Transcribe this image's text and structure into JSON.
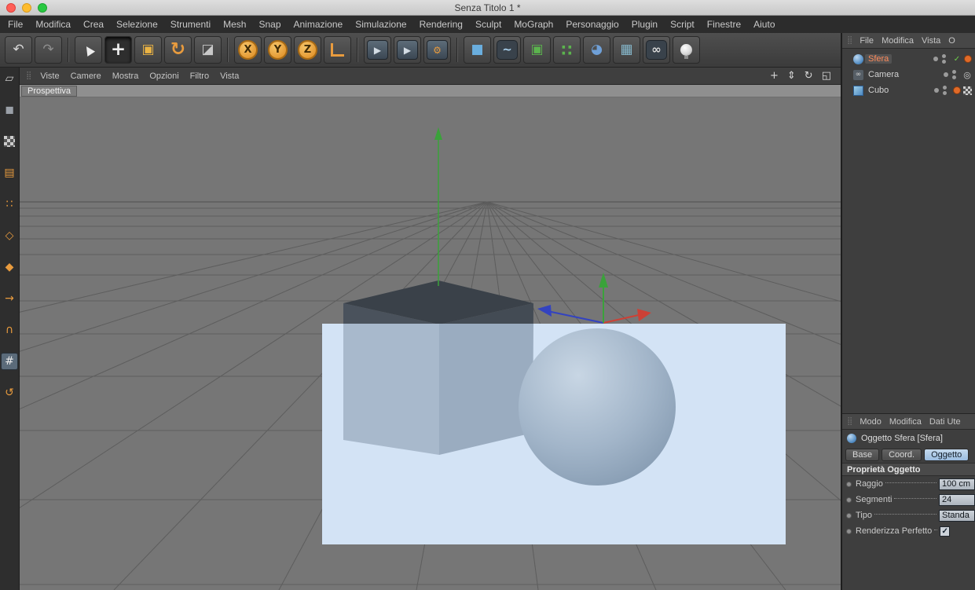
{
  "window": {
    "title": "Senza Titolo 1 *"
  },
  "colors": {
    "accent_orange": "#e89b3e",
    "selected_object_text": "#ff8a5a",
    "axis_x": "#cc4136",
    "axis_y": "#3aa23a",
    "axis_z": "#3343c0",
    "render_region_blue": "#d3e3f5",
    "active_tab_blue": "#a9c6e4"
  },
  "menu_bar": {
    "items": [
      "File",
      "Modifica",
      "Crea",
      "Selezione",
      "Strumenti",
      "Mesh",
      "Snap",
      "Animazione",
      "Simulazione",
      "Rendering",
      "Sculpt",
      "MoGraph",
      "Personaggio",
      "Plugin",
      "Script",
      "Finestre",
      "Aiuto"
    ]
  },
  "toolbar": {
    "items": [
      {
        "name": "undo-icon",
        "glyph": "↶",
        "color": "#d9d9d9"
      },
      {
        "name": "redo-icon",
        "glyph": "↷",
        "color": "#8f8f8f"
      },
      {
        "name": "sep"
      },
      {
        "name": "live-selection-icon",
        "glyph": "▲",
        "color": "#ededed",
        "cls": "cursor"
      },
      {
        "name": "move-tool-icon",
        "glyph": "+",
        "color": "#ededed",
        "cls": "big",
        "pressed": true
      },
      {
        "name": "scale-tool-icon",
        "glyph": "▣",
        "color": "#eab344"
      },
      {
        "name": "rotate-tool-icon",
        "glyph": "↻",
        "color": "#e89b3e",
        "cls": "big"
      },
      {
        "name": "last-tool-icon",
        "glyph": "◪",
        "color": "#c9c9c9"
      },
      {
        "name": "sep"
      },
      {
        "name": "lock-x-axis-icon",
        "glyph": "X",
        "cls": "axis"
      },
      {
        "name": "lock-y-axis-icon",
        "glyph": "Y",
        "cls": "axis"
      },
      {
        "name": "lock-z-axis-icon",
        "glyph": "Z",
        "cls": "axis"
      },
      {
        "name": "coordinate-system-icon",
        "glyph": "",
        "cls": "coord"
      },
      {
        "name": "sep"
      },
      {
        "name": "render-view-icon",
        "glyph": "▶",
        "color": "#d3dce4",
        "cls": "render"
      },
      {
        "name": "render-picture-viewer-icon",
        "glyph": "▶",
        "color": "#d3dce4",
        "cls": "render"
      },
      {
        "name": "render-settings-icon",
        "glyph": "⚙",
        "color": "#e89b3e",
        "cls": "render"
      },
      {
        "name": "sep"
      },
      {
        "name": "add-cube-icon",
        "glyph": "■",
        "color": "#6aaede"
      },
      {
        "name": "add-spline-icon",
        "glyph": "~",
        "color": "#a9d0ec",
        "cls": "dark"
      },
      {
        "name": "subdivision-surface-icon",
        "glyph": "▣",
        "color": "#5cb44e"
      },
      {
        "name": "cloner-icon",
        "glyph": "∷",
        "color": "#5cb44e",
        "cls": "big2"
      },
      {
        "name": "deformer-icon",
        "glyph": "◕",
        "color": "#6fa0d8"
      },
      {
        "name": "environment-icon",
        "glyph": "▦",
        "color": "#86b8cc"
      },
      {
        "name": "scene-camera-icon",
        "glyph": "∞",
        "color": "#dcdcdc",
        "cls": "dark"
      },
      {
        "name": "light-icon",
        "glyph": "",
        "cls": "bulb"
      }
    ]
  },
  "sidebar": {
    "items": [
      {
        "name": "make-editable-icon",
        "glyph": "▱",
        "color": "#c9c9c9"
      },
      {
        "name": "model-mode-icon",
        "glyph": "◼",
        "color": "#9aa0a8"
      },
      {
        "name": "texture-mode-icon",
        "glyph": "",
        "cls": "checker"
      },
      {
        "name": "workplane-mode-icon",
        "glyph": "▤",
        "color": "#e89b3e"
      },
      {
        "name": "points-mode-icon",
        "glyph": "∷",
        "color": "#e89b3e"
      },
      {
        "name": "edges-mode-icon",
        "glyph": "◇",
        "color": "#e89b3e"
      },
      {
        "name": "polygons-mode-icon",
        "glyph": "◆",
        "color": "#e89b3e"
      },
      {
        "name": "enable-axis-icon",
        "glyph": "→",
        "color": "#e89b3e"
      },
      {
        "name": "normal-move-icon",
        "glyph": "∩",
        "color": "#e89b3e"
      },
      {
        "name": "snap-toggle-icon",
        "glyph": "#",
        "color": "#e8e8e8",
        "selected": true
      },
      {
        "name": "quantize-icon",
        "glyph": "↺",
        "color": "#e89b3e"
      }
    ]
  },
  "viewport": {
    "menu": [
      "Viste",
      "Camere",
      "Mostra",
      "Opzioni",
      "Filtro",
      "Vista"
    ],
    "view_label": "Prospettiva",
    "nav_icons": [
      {
        "name": "viewport-pan-icon",
        "glyph": "+"
      },
      {
        "name": "viewport-zoom-icon",
        "glyph": "⇕"
      },
      {
        "name": "viewport-rotate-icon",
        "glyph": "↻"
      },
      {
        "name": "viewport-toggle-icon",
        "glyph": "◱"
      }
    ]
  },
  "object_manager": {
    "menu": [
      "File",
      "Modifica",
      "Vista",
      "O"
    ],
    "objects": [
      {
        "label": "Sfera",
        "icon": "sphere",
        "selected": true,
        "tags": [
          "check",
          "orange-dot"
        ]
      },
      {
        "label": "Camera",
        "icon": "camera",
        "selected": false,
        "tags": [
          "target"
        ]
      },
      {
        "label": "Cubo",
        "icon": "cube",
        "selected": false,
        "tags": [
          "orange-dot",
          "checker"
        ]
      }
    ]
  },
  "attribute_manager": {
    "menu": [
      "Modo",
      "Modifica",
      "Dati Ute"
    ],
    "object_title": "Oggetto Sfera [Sfera]",
    "tabs": [
      {
        "label": "Base",
        "active": false
      },
      {
        "label": "Coord.",
        "active": false
      },
      {
        "label": "Oggetto",
        "active": true
      }
    ],
    "section_title": "Proprietà Oggetto",
    "properties": [
      {
        "label": "Raggio",
        "value": "100 cm",
        "control": "input"
      },
      {
        "label": "Segmenti",
        "value": "24",
        "control": "input"
      },
      {
        "label": "Tipo",
        "value": "Standa",
        "control": "select"
      },
      {
        "label": "Renderizza Perfetto",
        "value": "✓",
        "control": "checkbox"
      }
    ]
  }
}
